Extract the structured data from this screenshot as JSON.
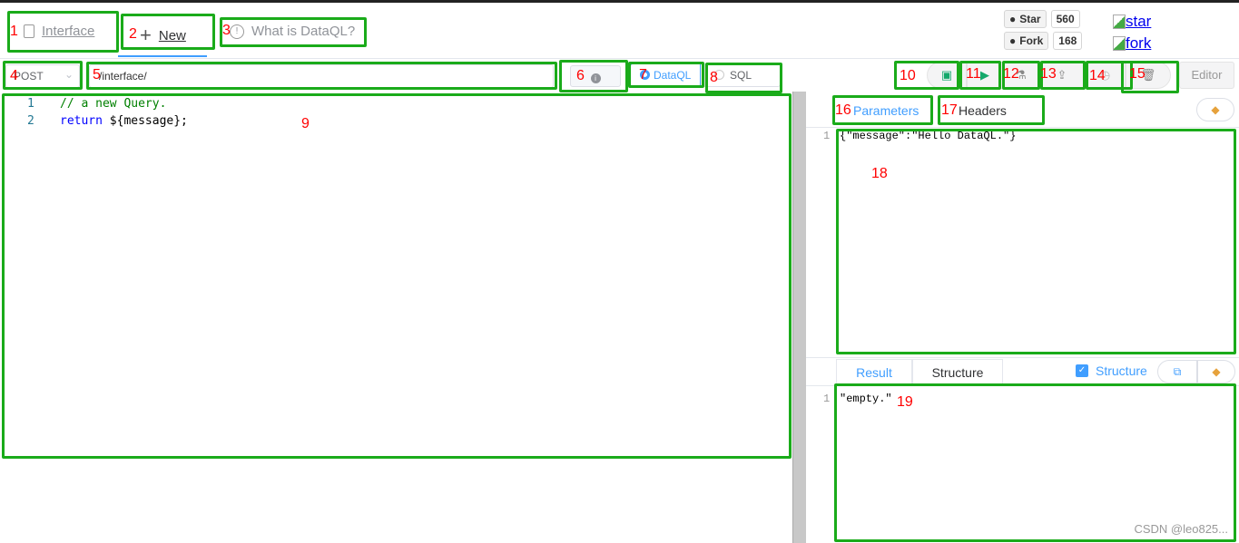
{
  "nav": {
    "interface": "Interface",
    "new": "New",
    "what_is": "What is DataQL?"
  },
  "github": {
    "star_label": "Star",
    "star_count": "560",
    "fork_label": "Fork",
    "fork_count": "168",
    "star_img_alt": "star",
    "fork_img_alt": "fork"
  },
  "toolbar": {
    "method": "POST",
    "path": "/interface/",
    "info_icon": "info-icon",
    "mode_options": [
      "DataQL",
      "SQL"
    ],
    "mode_selected": "DataQL",
    "editor_label": "Editor"
  },
  "editor": {
    "lines": [
      {
        "n": "1",
        "text": "// a new Query."
      },
      {
        "n": "2",
        "kw": "return",
        "rest": " ${message};"
      }
    ]
  },
  "params": {
    "tabs": [
      "Parameters",
      "Headers"
    ],
    "active": "Parameters",
    "line_no": "1",
    "content": "{\"message\":\"Hello DataQL.\"}"
  },
  "result": {
    "tabs": [
      "Result",
      "Structure"
    ],
    "active": "Result",
    "structure_checkbox_label": "Structure",
    "structure_checked": true,
    "line_no": "1",
    "content": "\"empty.\""
  },
  "annotations": [
    "1",
    "2",
    "3",
    "4",
    "5",
    "6",
    "7",
    "8",
    "9",
    "10",
    "11",
    "12",
    "13",
    "14",
    "15",
    "16",
    "17",
    "18",
    "19"
  ],
  "watermark": "CSDN @leo825...",
  "colors": {
    "accent": "#409eff",
    "annotation_box": "#1aab1a",
    "annotation_number": "#ff0000",
    "run": "#13a86b"
  }
}
